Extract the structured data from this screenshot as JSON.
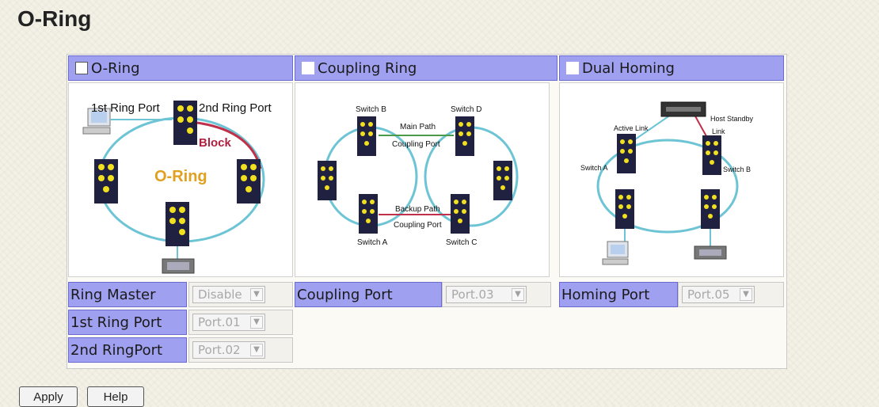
{
  "page": {
    "title": "O-Ring"
  },
  "panels": {
    "oring": {
      "header": "O-Ring",
      "diagram": {
        "first_port": "1st Ring Port",
        "second_port": "2nd Ring Port",
        "block": "Block",
        "center": "O-Ring"
      }
    },
    "coupling": {
      "header": "Coupling Ring",
      "diagram": {
        "switch_b": "Switch B",
        "switch_d": "Switch D",
        "switch_a": "Switch A",
        "switch_c": "Switch C",
        "main_path": "Main Path",
        "coupling_port_top": "Coupling Port",
        "backup_path": "Backup Path",
        "coupling_port_bottom": "Coupling Port"
      }
    },
    "dual": {
      "header": "Dual Homing",
      "diagram": {
        "host_standby": "Host Standby",
        "link": "Link",
        "active_link": "Active Link",
        "switch_a": "Switch A",
        "switch_b": "Switch B"
      }
    }
  },
  "settings": {
    "ring_master": {
      "label": "Ring Master",
      "value": "Disable"
    },
    "first_ring_port": {
      "label": "1st Ring Port",
      "value": "Port.01"
    },
    "second_ring_port": {
      "label": "2nd RingPort",
      "value": "Port.02"
    },
    "coupling_port": {
      "label": "Coupling Port",
      "value": "Port.03"
    },
    "homing_port": {
      "label": "Homing Port",
      "value": "Port.05"
    }
  },
  "buttons": {
    "apply": "Apply",
    "help": "Help"
  }
}
